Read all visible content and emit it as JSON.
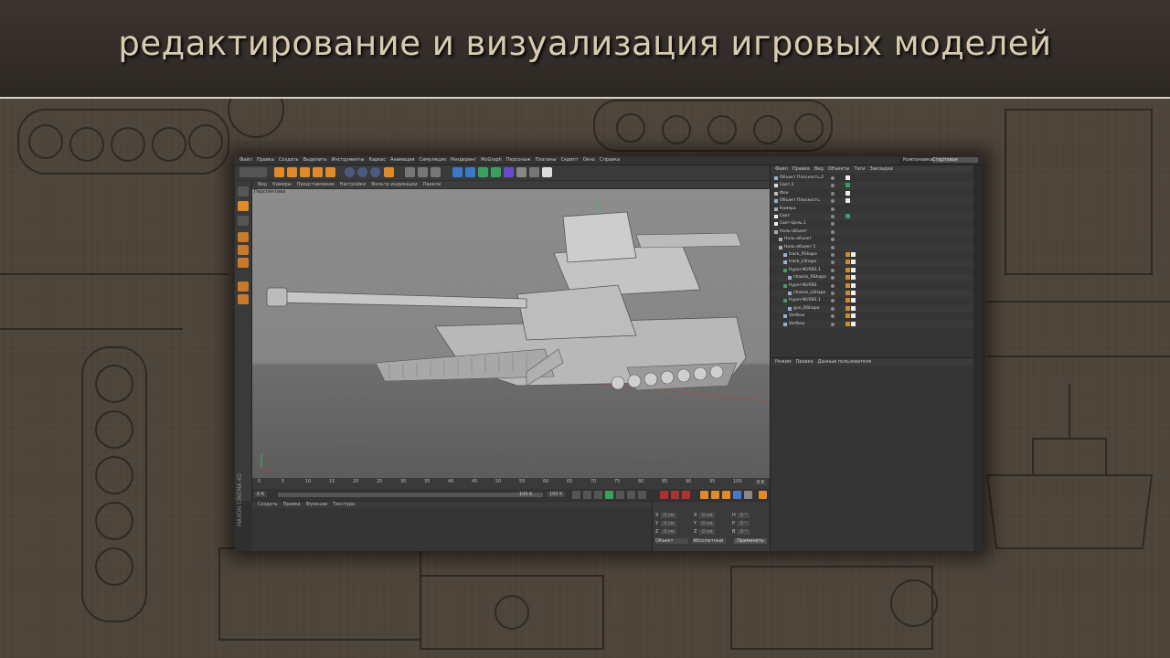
{
  "slide": {
    "title": "редактирование и визуализация игровых моделей"
  },
  "menu": [
    "Файл",
    "Правка",
    "Создать",
    "Выделить",
    "Инструменты",
    "Каркас",
    "Анимация",
    "Симуляция",
    "Рендеринг",
    "MoGraph",
    "Персонаж",
    "Плагины",
    "Скрипт",
    "Окно",
    "Справка"
  ],
  "layout_selector": {
    "label": "Компоновка:",
    "value": "Стартовая"
  },
  "viewport": {
    "menu": [
      "Вид",
      "Камеры",
      "Представление",
      "Настройки",
      "Фильтр индикации",
      "Панели"
    ],
    "label": "Перспектива"
  },
  "timeline": {
    "ticks": [
      "0",
      "5",
      "10",
      "15",
      "20",
      "25",
      "30",
      "35",
      "40",
      "45",
      "50",
      "55",
      "60",
      "65",
      "70",
      "75",
      "80",
      "85",
      "90",
      "95",
      "100"
    ],
    "current_frame": "0 K",
    "start": "0 K",
    "end": "100 K",
    "end2": "100 K"
  },
  "material_manager": {
    "menu": [
      "Создать",
      "Правка",
      "Функции",
      "Текстура"
    ]
  },
  "coordinates": {
    "rows": [
      {
        "a": "X",
        "av": "0 см",
        "b": "X",
        "bv": "0 см",
        "c": "H",
        "cv": "0 °"
      },
      {
        "a": "Y",
        "av": "0 см",
        "b": "Y",
        "bv": "0 см",
        "c": "P",
        "cv": "0 °"
      },
      {
        "a": "Z",
        "av": "0 см",
        "b": "Z",
        "bv": "0 см",
        "c": "B",
        "cv": "0 °"
      }
    ],
    "mode1": "Объект",
    "mode2": "Абсолютный",
    "apply": "Применить"
  },
  "brand": "MAXON CINEMA 4D",
  "object_manager": {
    "menu": [
      "Файл",
      "Правка",
      "Вид",
      "Объекты",
      "Теги",
      "Закладки"
    ],
    "objects": [
      {
        "name": "Объект Плоскость.2",
        "indent": 0
      },
      {
        "name": "Свет.2",
        "indent": 0
      },
      {
        "name": "Фон",
        "indent": 0
      },
      {
        "name": "Объект Плоскость",
        "indent": 0
      },
      {
        "name": "Камера",
        "indent": 0
      },
      {
        "name": "Свет",
        "indent": 0
      },
      {
        "name": "Свет-Цель.1",
        "indent": 0
      },
      {
        "name": "Ноль-объект",
        "indent": 0
      },
      {
        "name": "Ноль-объект",
        "indent": 1
      },
      {
        "name": "Ноль-объект.1",
        "indent": 1
      },
      {
        "name": "track_RShape",
        "indent": 2
      },
      {
        "name": "track_LShape",
        "indent": 2
      },
      {
        "name": "Hyper-NURBS.1",
        "indent": 2
      },
      {
        "name": "chassis_RShape",
        "indent": 3
      },
      {
        "name": "Hyper-NURBS",
        "indent": 2
      },
      {
        "name": "chassis_LShape",
        "indent": 3
      },
      {
        "name": "Hyper-NURBS.1",
        "indent": 2
      },
      {
        "name": "gun_DShape",
        "indent": 3
      },
      {
        "name": "Vertbox",
        "indent": 2
      },
      {
        "name": "Vertbox",
        "indent": 2
      }
    ]
  },
  "attribute_manager": {
    "menu": [
      "Режим",
      "Правка",
      "Данные пользователя"
    ]
  },
  "colors": {
    "accent": "#e08a2a",
    "viewport": "#8a8a8a",
    "panel": "#353535"
  }
}
